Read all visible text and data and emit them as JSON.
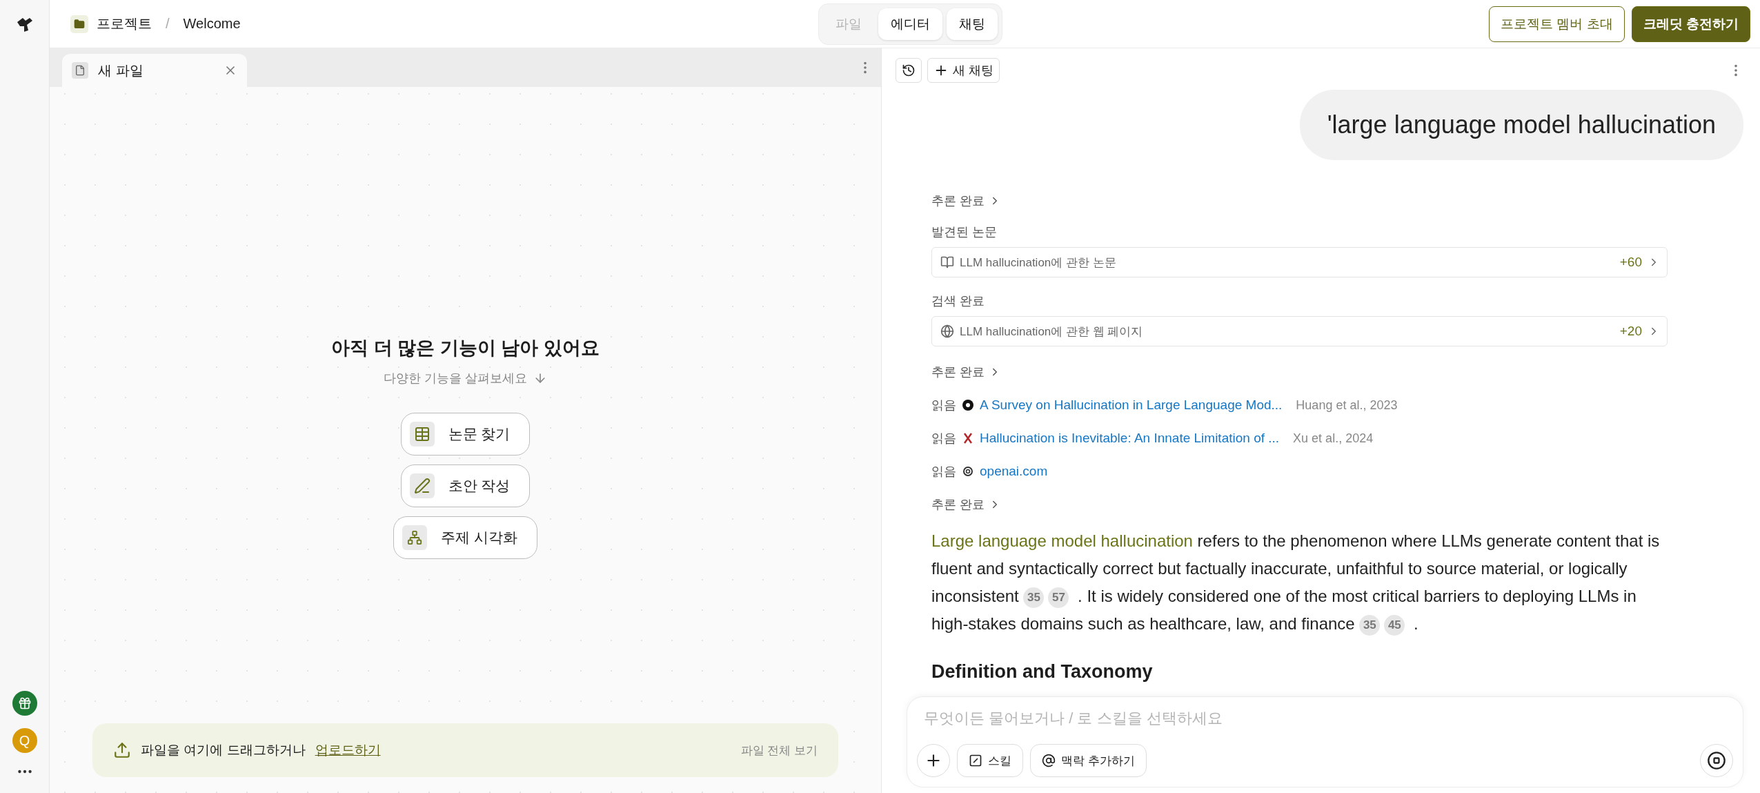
{
  "sidebar": {
    "avatar_letter": "Q"
  },
  "breadcrumb": {
    "project": "프로젝트",
    "separator": "/",
    "page": "Welcome"
  },
  "view_tabs": [
    {
      "label": "파일",
      "selected": false
    },
    {
      "label": "에디터",
      "selected": true
    },
    {
      "label": "채팅",
      "selected": true
    }
  ],
  "header_buttons": [
    {
      "label": "프로젝트 멤버 초대",
      "kind": "outline"
    },
    {
      "label": "크레딧 충전하기",
      "kind": "filled"
    }
  ],
  "editor": {
    "tabs": [
      {
        "label": "새 파일",
        "selected": true
      }
    ],
    "heading": "아직 더 많은 기능이 남아 있어요",
    "subheading": "다양한 기능을 살펴보세요",
    "actions": [
      {
        "label": "논문 찾기",
        "kind": "table"
      },
      {
        "label": "초안 작성",
        "kind": "draft"
      },
      {
        "label": "주제 시각화",
        "kind": "tree"
      }
    ],
    "upload_bar": {
      "text": "파일을 여기에 드래그하거나",
      "link": "업로드하기",
      "view_all": "파일 전체 보기"
    }
  },
  "chat": {
    "new_chat": "새 채팅",
    "user_message": "'large language model hallucination",
    "steps": [
      {
        "kind": "status",
        "label": "추론 완료"
      },
      {
        "kind": "label",
        "label": "발견된 논문"
      },
      {
        "kind": "paper_result",
        "text": "LLM hallucination에 관한 논문",
        "count": "+60"
      },
      {
        "kind": "label",
        "label": "검색 완료"
      },
      {
        "kind": "web_result",
        "text": "LLM hallucination에 관한 웹 페이지",
        "count": "+20"
      },
      {
        "kind": "status",
        "label": "추론 완료"
      },
      {
        "kind": "read",
        "label": "읽음",
        "title": "A Survey on Hallucination in Large Language Mod...",
        "meta": "Huang et al., 2023"
      },
      {
        "kind": "read",
        "label": "읽음",
        "title": "Hallucination is Inevitable: An Innate Limitation of ...",
        "meta": "Xu et al., 2024"
      },
      {
        "kind": "read",
        "label": "읽음",
        "title": "openai.com"
      },
      {
        "kind": "status",
        "label": "추론 완료"
      }
    ],
    "answer": [
      {
        "kind": "highlight",
        "text": "Large language model hallucination"
      },
      {
        "kind": "text",
        "text": " refers to the phenomenon where LLMs generate content that is fluent and syntactically correct but factually inaccurate, unfaithful to source material, or logically inconsistent "
      },
      {
        "kind": "cite",
        "text": "35"
      },
      {
        "kind": "cite",
        "text": "57"
      },
      {
        "kind": "text",
        "text": " . It is widely considered one of the most critical barriers to deploying LLMs in high-stakes domains such as healthcare, law, and finance "
      },
      {
        "kind": "cite",
        "text": "35"
      },
      {
        "kind": "cite",
        "text": "45"
      },
      {
        "kind": "text",
        "text": " ."
      }
    ],
    "section_heading": "Definition and Taxonomy",
    "composer": {
      "placeholder": "무엇이든 물어보거나 / 로 스킬을 선택하세요",
      "skill": "스킬",
      "context": "맥락 추가하기"
    }
  }
}
